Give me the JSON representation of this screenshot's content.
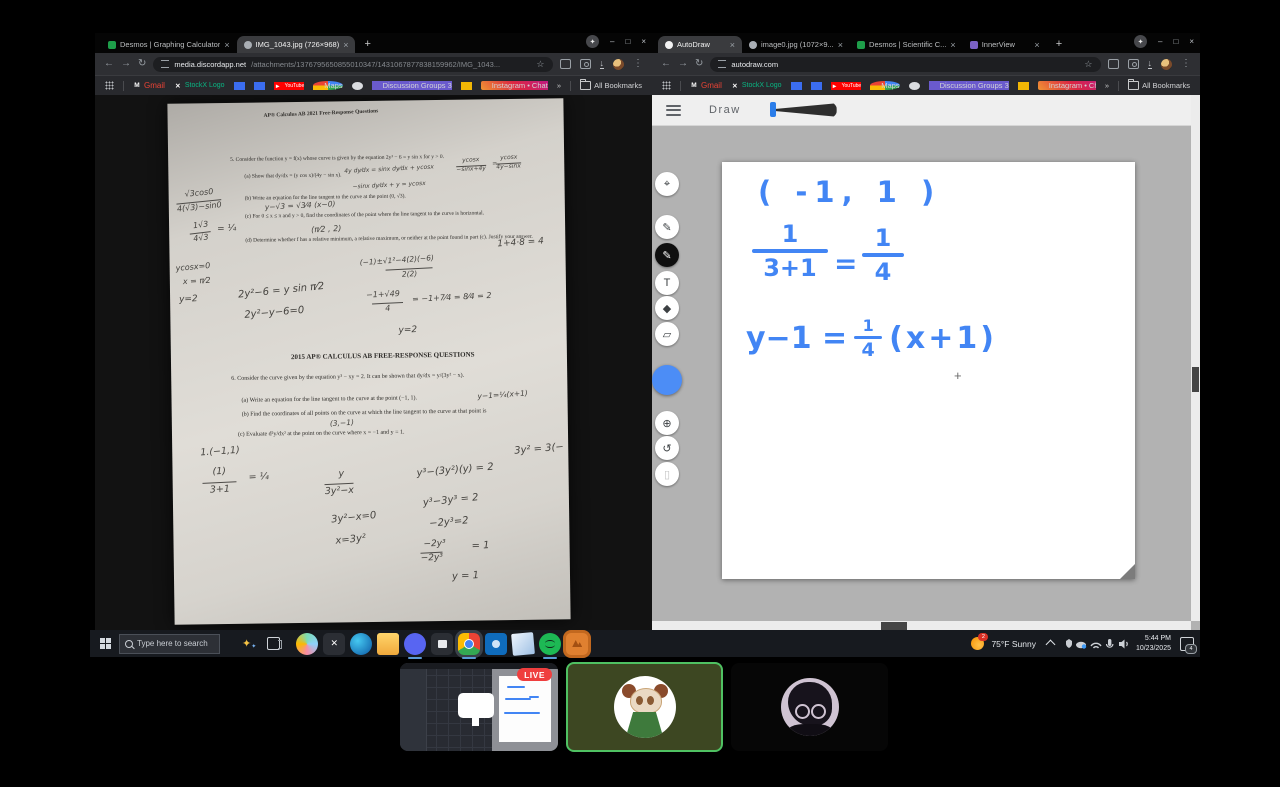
{
  "glyphs": {
    "close": "×",
    "back": "←",
    "forward": "→",
    "reload": "↻",
    "star": "☆",
    "kebab": "⋮",
    "minimize": "–",
    "maximize": "□",
    "x": "×",
    "sparkle": "✦",
    "newtab": "+",
    "more": "»",
    "download": "↓",
    "play": "▸"
  },
  "chrome": {
    "left": {
      "tabs": [
        {
          "label": "Desmos | Graphing Calculator",
          "cls": "fav-is-desmos",
          "fav": "fav-desmos"
        },
        {
          "label": "IMG_1043.jpg (726×968)",
          "cls": "active",
          "fav": "fav-globe"
        }
      ],
      "url_host": "media.discordapp.net",
      "url_path": "/attachments/1376795650855010347/1431067877838159962/IMG_1043..."
    },
    "right": {
      "tabs": [
        {
          "label": "AutoDraw",
          "cls": "active",
          "fav": "fav-autodraw"
        },
        {
          "label": "image0.jpg (1072×9...",
          "cls": "",
          "fav": "fav-globe"
        },
        {
          "label": "Desmos | Scientific C...",
          "cls": "",
          "fav": "fav-desmos"
        },
        {
          "label": "InnerView",
          "cls": "",
          "fav": "fav-innerview"
        }
      ],
      "url_host": "autodraw.com",
      "url_path": ""
    },
    "bookmarks": {
      "items": [
        {
          "label": "Gmail",
          "cls": "f-gmail",
          "icon": "M"
        },
        {
          "label": "StockX Logo",
          "cls": "f-stockx",
          "icon": "✕"
        },
        {
          "label": "",
          "cls": "f-blue1",
          "icon": ""
        },
        {
          "label": "",
          "cls": "f-blue2",
          "icon": ""
        },
        {
          "label": "YouTube",
          "cls": "f-yt",
          "icon": "▸"
        },
        {
          "label": "Maps",
          "cls": "f-maps",
          "icon": ""
        },
        {
          "label": "",
          "cls": "f-globe",
          "icon": ""
        },
        {
          "label": "Discussion Groups 3",
          "cls": "f-dg",
          "icon": ""
        },
        {
          "label": "",
          "cls": "f-yellow",
          "icon": ""
        },
        {
          "label": "Instagram • Chats",
          "cls": "f-insta",
          "icon": ""
        }
      ],
      "all_label": "All Bookmarks"
    }
  },
  "autodraw": {
    "title": "Draw",
    "tools": [
      {
        "g": "⌖",
        "cls": "",
        "style": "top:77px",
        "name": "move"
      },
      {
        "g": "✎",
        "cls": "t-magic",
        "style": "top:120px",
        "name": "autodraw-suggest"
      },
      {
        "g": "✎",
        "cls": "sel",
        "style": "top:148px",
        "name": "draw"
      },
      {
        "g": "T",
        "cls": "",
        "style": "top:176px",
        "name": "text"
      },
      {
        "g": "◆",
        "cls": "",
        "style": "top:201px",
        "name": "fill"
      },
      {
        "g": "▱",
        "cls": "",
        "style": "top:227px",
        "name": "shapes"
      },
      {
        "g": "",
        "cls": "color",
        "style": "top:270px;left:0;width:30px;height:30px",
        "name": "color"
      },
      {
        "g": "⊕",
        "cls": "",
        "style": "top:316px",
        "name": "zoom"
      },
      {
        "g": "↺",
        "cls": "",
        "style": "top:341px",
        "name": "undo"
      },
      {
        "g": "▯",
        "cls": "dim",
        "style": "top:367px",
        "name": "trash"
      }
    ]
  },
  "whiteboard": {
    "coord": "( -1, 1 )",
    "f1n": "1",
    "f1d": "3+1",
    "eq": "=",
    "f2n": "1",
    "f2d": "4",
    "l3a": "y−1 =",
    "l3fn": "1",
    "l3fd": "4",
    "l3b": "(x+1)",
    "cursor": "+",
    "ink_color": "#4285f4"
  },
  "paper": {
    "print": [
      {
        "t": "AP® Calculus AB 2021 Free-Response Questions",
        "style": "left:96px;top:8px;font-size:5.5px;transform:rotate(-1.5deg);font-weight:bold"
      },
      {
        "t": "5.  Consider the function y = f(x) whose curve is given by the equation 2y³ − 6 = y sin x for y > 0.",
        "style": "left:62px;top:53px;width:332px"
      },
      {
        "t": "(a)  Show that dy/dx = (y cos x)/(4y − sin x).",
        "style": "left:76px;top:70px;width:150px"
      },
      {
        "t": "(b)  Write an equation for the line tangent to the curve at the point (0, √3).",
        "style": "left:76px;top:92px;width:320px"
      },
      {
        "t": "(c)  For 0 ≤ x ≤ π and y > 0, find the coordinates of the point where the line tangent to the curve is horizontal.",
        "style": "left:76px;top:110px;width:312px"
      },
      {
        "t": "(d)  Determine whether f has a relative minimum, a relative maximum, or neither at the point found in part (c). Justify your answer.",
        "style": "left:76px;top:134px;width:318px"
      },
      {
        "t": "2015 AP® CALCULUS AB FREE-RESPONSE QUESTIONS",
        "style": "left:120px;top:250px;font-size:7px;font-weight:bold;width:240px"
      },
      {
        "t": "6.  Consider the curve given by the equation y³ − xy = 2. It can be shown that dy/dx = y/(3y² − x).",
        "style": "left:60px;top:272px;width:320px;font-size:6px"
      },
      {
        "t": "(a)  Write an equation for the line tangent to the curve at the point (−1, 1).",
        "style": "left:70px;top:294px;width:240px;font-size:6px"
      },
      {
        "t": "(b)  Find the coordinates of all points on the curve at which the line tangent to the curve at that point is",
        "style": "left:70px;top:308px;width:330px;font-size:6px"
      },
      {
        "t": "(c)  Evaluate d²y/dx² at the point on the curve where x = −1 and y = 1.",
        "style": "left:66px;top:328px;width:260px;font-size:6px"
      }
    ],
    "hand": [
      {
        "t": "√3cos0",
        "style": "left:16px;top:86px;font-size:8px;transform:rotate(-5deg)"
      },
      {
        "t": "4(√3)−sin0",
        "style": "left:8px;top:98px;font-size:8px;border-top:1px solid #4d4b48;padding-top:1px;transform:rotate(-5deg)"
      },
      {
        "t": "1√3",
        "style": "left:24px;top:118px;font-size:8px;transform:rotate(-6deg)"
      },
      {
        "t": "4√3",
        "style": "left:21px;top:129px;font-size:8px;border-top:1px solid #4d4b48;padding:1px 3px 0;transform:rotate(-6deg)"
      },
      {
        "t": "= ¼",
        "style": "left:48px;top:122px;font-size:9px"
      },
      {
        "t": "ycosx=0",
        "style": "left:6px;top:160px;font-size:8px;transform:rotate(-4deg)"
      },
      {
        "t": "x = π⁄2",
        "style": "left:13px;top:174px;font-size:8px"
      },
      {
        "t": "y=2",
        "style": "left:9px;top:192px;font-size:9px"
      },
      {
        "t": "4y dy⁄dx = sinx dy⁄dx + ycosx",
        "style": "left:176px;top:66px;font-size:6px"
      },
      {
        "t": "−sinx dy⁄dx + y = ycosx",
        "style": "left:184px;top:82px;font-size:6px"
      },
      {
        "t": "ycosx",
        "style": "left:294px;top:58px;font-size:6px"
      },
      {
        "t": "−sinx+4y",
        "style": "left:288px;top:66px;font-size:6px;border-top:1px solid #4d4b48"
      },
      {
        "t": "=",
        "style": "left:324px;top:62px;font-size:6px"
      },
      {
        "t": "ycosx",
        "style": "left:332px;top:56px;font-size:6px"
      },
      {
        "t": "4y−sinx",
        "style": "left:328px;top:64px;font-size:6px;border-top:1px solid #4d4b48"
      },
      {
        "t": "y−√3 = √3⁄4 (x−0)",
        "style": "left:96px;top:100px;font-size:7.5px;transform:rotate(-2deg)"
      },
      {
        "t": "(π⁄2 , 2)",
        "style": "left:142px;top:124px;font-size:8px"
      },
      {
        "t": "1+4·8 = 4",
        "style": "left:328px;top:140px;font-size:9px;transform:rotate(-3deg)"
      },
      {
        "t": "(−1)±√1²−4(2)(−6)",
        "style": "left:190px;top:156px;font-size:7.5px;transform:rotate(-3deg)"
      },
      {
        "t": "2(2)",
        "style": "left:216px;top:168px;font-size:7.5px;border-top:1px solid #4d4b48;padding:1px 16px 0"
      },
      {
        "t": "2y²−6 = y sin π⁄2",
        "style": "left:68px;top:184px;font-size:10px;transform:rotate(-5deg)"
      },
      {
        "t": "2y²−y−6=0",
        "style": "left:74px;top:206px;font-size:10px;transform:rotate(-4deg)"
      },
      {
        "t": "−1+√49",
        "style": "left:196px;top:190px;font-size:8px"
      },
      {
        "t": "4",
        "style": "left:202px;top:202px;font-size:8px;border-top:1px solid #4d4b48;padding:1px 13px 0"
      },
      {
        "t": "= −1+7⁄4 = 8⁄4 = 2",
        "style": "left:242px;top:194px;font-size:8px"
      },
      {
        "t": "y=2",
        "style": "left:228px;top:226px;font-size:9px"
      },
      {
        "t": "y−1=¼(x+1)",
        "style": "left:306px;top:292px;font-size:7.5px;transform:rotate(-3deg)"
      },
      {
        "t": "(3,−1)",
        "style": "left:158px;top:318px;font-size:7.5px"
      },
      {
        "t": "1.(−1,1)",
        "style": "left:28px;top:344px;font-size:9.5px;transform:rotate(-3deg)"
      },
      {
        "t": "(1)",
        "style": "left:40px;top:364px;font-size:9.5px"
      },
      {
        "t": "3+1",
        "style": "left:30px;top:379px;font-size:9.5px;border-top:1px solid #4d4b48;padding:2px 7px 0"
      },
      {
        "t": "= ¼",
        "style": "left:76px;top:370px;font-size:9.5px"
      },
      {
        "t": "y",
        "style": "left:166px;top:368px;font-size:9.5px"
      },
      {
        "t": "3y²−x",
        "style": "left:152px;top:382px;font-size:9.5px;border-top:1px solid #4d4b48;padding-top:2px"
      },
      {
        "t": "3y²−x=0",
        "style": "left:158px;top:412px;font-size:10px;transform:rotate(-5deg)"
      },
      {
        "t": "x=3y²",
        "style": "left:162px;top:434px;font-size:10px;transform:rotate(-5deg)"
      },
      {
        "t": "y³−(3y²)(y) = 2",
        "style": "left:244px;top:366px;font-size:10px;transform:rotate(-4deg)"
      },
      {
        "t": "3y² = 3(−",
        "style": "left:342px;top:346px;font-size:10px;transform:rotate(-4deg)"
      },
      {
        "t": "y³−3y³ = 2",
        "style": "left:250px;top:396px;font-size:10px;transform:rotate(-5deg)"
      },
      {
        "t": "−2y³=2",
        "style": "left:256px;top:418px;font-size:10px;transform:rotate(-4deg)"
      },
      {
        "t": "−2y³",
        "style": "left:250px;top:440px;font-size:9px"
      },
      {
        "t": "−2y³",
        "style": "left:247px;top:452px;font-size:9px;border-top:1px solid #4d4b48;padding-top:1px"
      },
      {
        "t": "= 1",
        "style": "left:298px;top:442px;font-size:10px"
      },
      {
        "t": "y = 1",
        "style": "left:278px;top:472px;font-size:10px"
      }
    ]
  },
  "taskbar": {
    "search_placeholder": "Type here to search",
    "weather": "75°F Sunny",
    "weather_badge": "2",
    "time": "5:44 PM",
    "date": "10/23/2025",
    "notif_badge": "4",
    "icons": [
      {
        "cls": "ti-copilot",
        "icon": ""
      },
      {
        "cls": "ti-xbox",
        "icon": "✕"
      },
      {
        "cls": "ti-edge",
        "icon": ""
      },
      {
        "cls": "ti-files",
        "icon": ""
      },
      {
        "cls": "ti-discord open",
        "icon": ""
      },
      {
        "cls": "ti-store",
        "icon": ""
      },
      {
        "cls": "ti-chrome open hl",
        "icon": ""
      },
      {
        "cls": "ti-outlook",
        "icon": ""
      },
      {
        "cls": "ti-notes",
        "icon": ""
      },
      {
        "cls": "ti-spotify open",
        "icon": ""
      },
      {
        "cls": "ti-rec hl-orange",
        "icon": ""
      }
    ]
  },
  "stream": {
    "live": "LIVE"
  }
}
